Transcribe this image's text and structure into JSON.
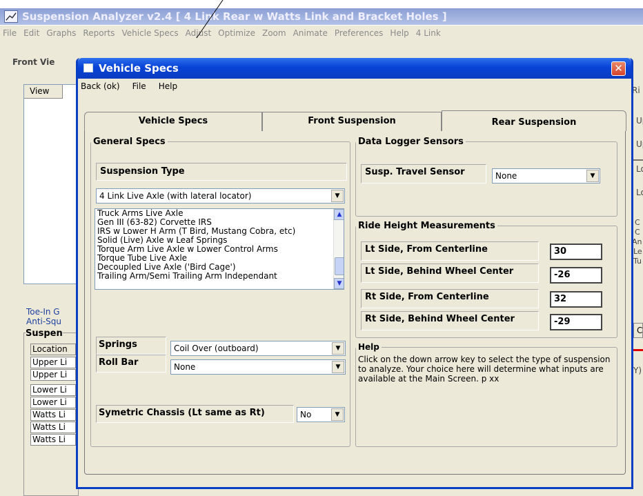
{
  "app": {
    "title": "Suspension Analyzer v2.4   [ 4 Link Rear w Watts Link and Bracket Holes ]",
    "menu": [
      "File",
      "Edit",
      "Graphs",
      "Reports",
      "Vehicle Specs",
      "Adjust",
      "Optimize",
      "Zoom",
      "Animate",
      "Preferences",
      "Help",
      "4 Link"
    ],
    "front_view_label": "Front Vie",
    "view_header": "View",
    "toe_in": "Toe-In G",
    "anti_squat": "Anti-Squ",
    "suspension_header": "Suspen",
    "location_header": "Location",
    "rows": [
      "Upper Li",
      "Upper Li",
      "Lower Li",
      "Lower Li",
      "Watts Li",
      "Watts Li",
      "Watts Li"
    ],
    "right_labels": [
      "Ri",
      "Up",
      "Up",
      "Lo",
      "Lo",
      "C",
      "C",
      "An",
      "Le",
      "Tu",
      "C",
      "Y)"
    ]
  },
  "dialog": {
    "title": "Vehicle Specs",
    "close": "✕",
    "menu": [
      "Back (ok)",
      "File",
      "Help"
    ],
    "tabs": [
      "Vehicle Specs",
      "Front Suspension",
      "Rear Suspension"
    ],
    "general": {
      "legend": "General Specs",
      "susp_type_label": "Suspension Type",
      "susp_type_value": "4 Link Live Axle (with lateral locator)",
      "list_items": [
        "Truck Arms Live Axle",
        "Gen III (63-82) Corvette IRS",
        "IRS w Lower H Arm (T Bird, Mustang Cobra, etc)",
        "Solid (Live) Axle w Leaf Springs",
        "Torque Arm Live Axle w Lower Control Arms",
        "Torque Tube Live Axle",
        "Decoupled Live Axle ('Bird Cage')",
        "Trailing Arm/Semi Trailing Arm Independant"
      ],
      "springs_label": "Springs",
      "springs_value": "Coil Over (outboard)",
      "rollbar_label": "Roll Bar",
      "rollbar_value": "None",
      "symetric_label": "Symetric Chassis (Lt same as Rt)",
      "symetric_value": "No"
    },
    "logger": {
      "legend": "Data Logger Sensors",
      "travel_label": "Susp. Travel Sensor",
      "travel_value": "None"
    },
    "ride": {
      "legend": "Ride Height Measurements",
      "rows": [
        {
          "label": "Lt Side, From Centerline",
          "value": "30"
        },
        {
          "label": "Lt Side, Behind Wheel Center",
          "value": "-26"
        },
        {
          "label": "Rt Side, From Centerline",
          "value": "32"
        },
        {
          "label": "Rt Side, Behind Wheel Center",
          "value": "-29"
        }
      ]
    },
    "help": {
      "legend": "Help",
      "text": "Click on the down arrow key to select the type of suspension to analyze.  Your choice here will determine what inputs are available at the Main Screen.  p xx"
    }
  }
}
